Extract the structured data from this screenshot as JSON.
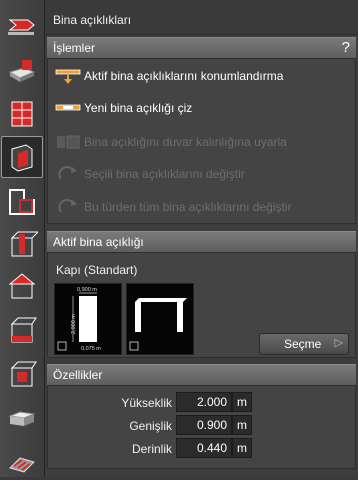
{
  "panel": {
    "title": "Bina açıklıkları"
  },
  "operations": {
    "header": "İşlemler",
    "help": "?",
    "actions": [
      {
        "label": "Aktif bina açıklıklarını konumlandırma",
        "enabled": true
      },
      {
        "label": "Yeni bina açıklığı çiz",
        "enabled": true
      },
      {
        "label": "Bina açıklığını duvar kalınlığına uyarla",
        "enabled": false
      },
      {
        "label": "Seçili bina açıklıklarını değiştir",
        "enabled": false
      },
      {
        "label": "Bu türden tüm bina açıklıklarını değiştir",
        "enabled": false
      }
    ]
  },
  "active_opening": {
    "header": "Aktif bina açıklığı",
    "type": "Kapı (Standart)",
    "dims": {
      "width": "0,900 m",
      "height": "2,000 m",
      "offset": "0,075 m"
    },
    "select_label": "Seçme",
    "select_arrow": "▷"
  },
  "properties": {
    "header": "Özellikler",
    "rows": [
      {
        "label": "Yükseklik",
        "value": "2.000",
        "unit": "m"
      },
      {
        "label": "Genişlik",
        "value": "0.900",
        "unit": "m"
      },
      {
        "label": "Derinlik",
        "value": "0.440",
        "unit": "m"
      }
    ]
  },
  "colors": {
    "accent_red": "#d42a2a",
    "accent_orange": "#f2a033"
  }
}
